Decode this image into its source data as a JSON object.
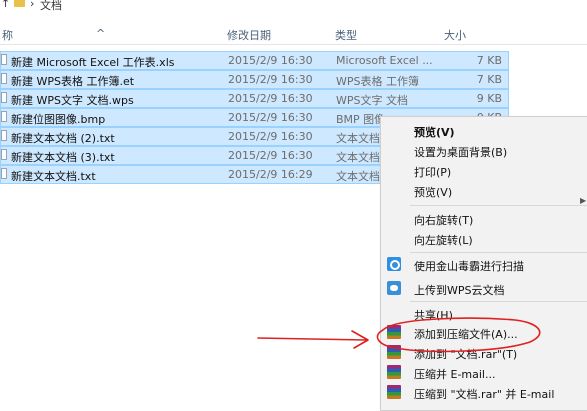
{
  "address": {
    "path": [
      "文档"
    ]
  },
  "columns": {
    "name": "称",
    "date": "修改日期",
    "type": "类型",
    "size": "大小"
  },
  "files": [
    {
      "name": "新建 Microsoft Excel 工作表.xls",
      "date": "2015/2/9 16:30",
      "type": "Microsoft Excel ...",
      "size": "7 KB"
    },
    {
      "name": "新建 WPS表格 工作簿.et",
      "date": "2015/2/9 16:30",
      "type": "WPS表格 工作簿",
      "size": "7 KB"
    },
    {
      "name": "新建 WPS文字 文档.wps",
      "date": "2015/2/9 16:30",
      "type": "WPS文字 文档",
      "size": "9 KB"
    },
    {
      "name": "新建位图图像.bmp",
      "date": "2015/2/9 16:30",
      "type": "BMP 图像",
      "size": "0 KB"
    },
    {
      "name": "新建文本文档 (2).txt",
      "date": "2015/2/9 16:30",
      "type": "文本文档",
      "size": ""
    },
    {
      "name": "新建文本文档 (3).txt",
      "date": "2015/2/9 16:30",
      "type": "文本文档",
      "size": ""
    },
    {
      "name": "新建文本文档.txt",
      "date": "2015/2/9 16:29",
      "type": "文本文档",
      "size": ""
    }
  ],
  "menu": {
    "preview_bold": "预览(V)",
    "set_desktop": "设置为桌面背景(B)",
    "print": "打印(P)",
    "preview": "预览(V)",
    "rotate_right": "向右旋转(T)",
    "rotate_left": "向左旋转(L)",
    "scan": "使用金山毒霸进行扫描",
    "upload": "上传到WPS云文档",
    "share": "共享(H)",
    "add_archive": "添加到压缩文件(A)...",
    "add_rar": "添加到 \"文档.rar\"(T)",
    "compress_email": "压缩并 E-mail...",
    "compress_rar_email": "压缩到 \"文档.rar\" 并 E-mail"
  },
  "icons": {
    "nav_up": "up-arrow-icon",
    "folder": "folder-icon",
    "separator": "chevron-right-icon",
    "submenu": "submenu-arrow-icon"
  },
  "colors": {
    "selection": "#cde8ff",
    "selection_border": "#99d1ff",
    "annotation": "#e02020",
    "header_text": "#4c607a"
  }
}
